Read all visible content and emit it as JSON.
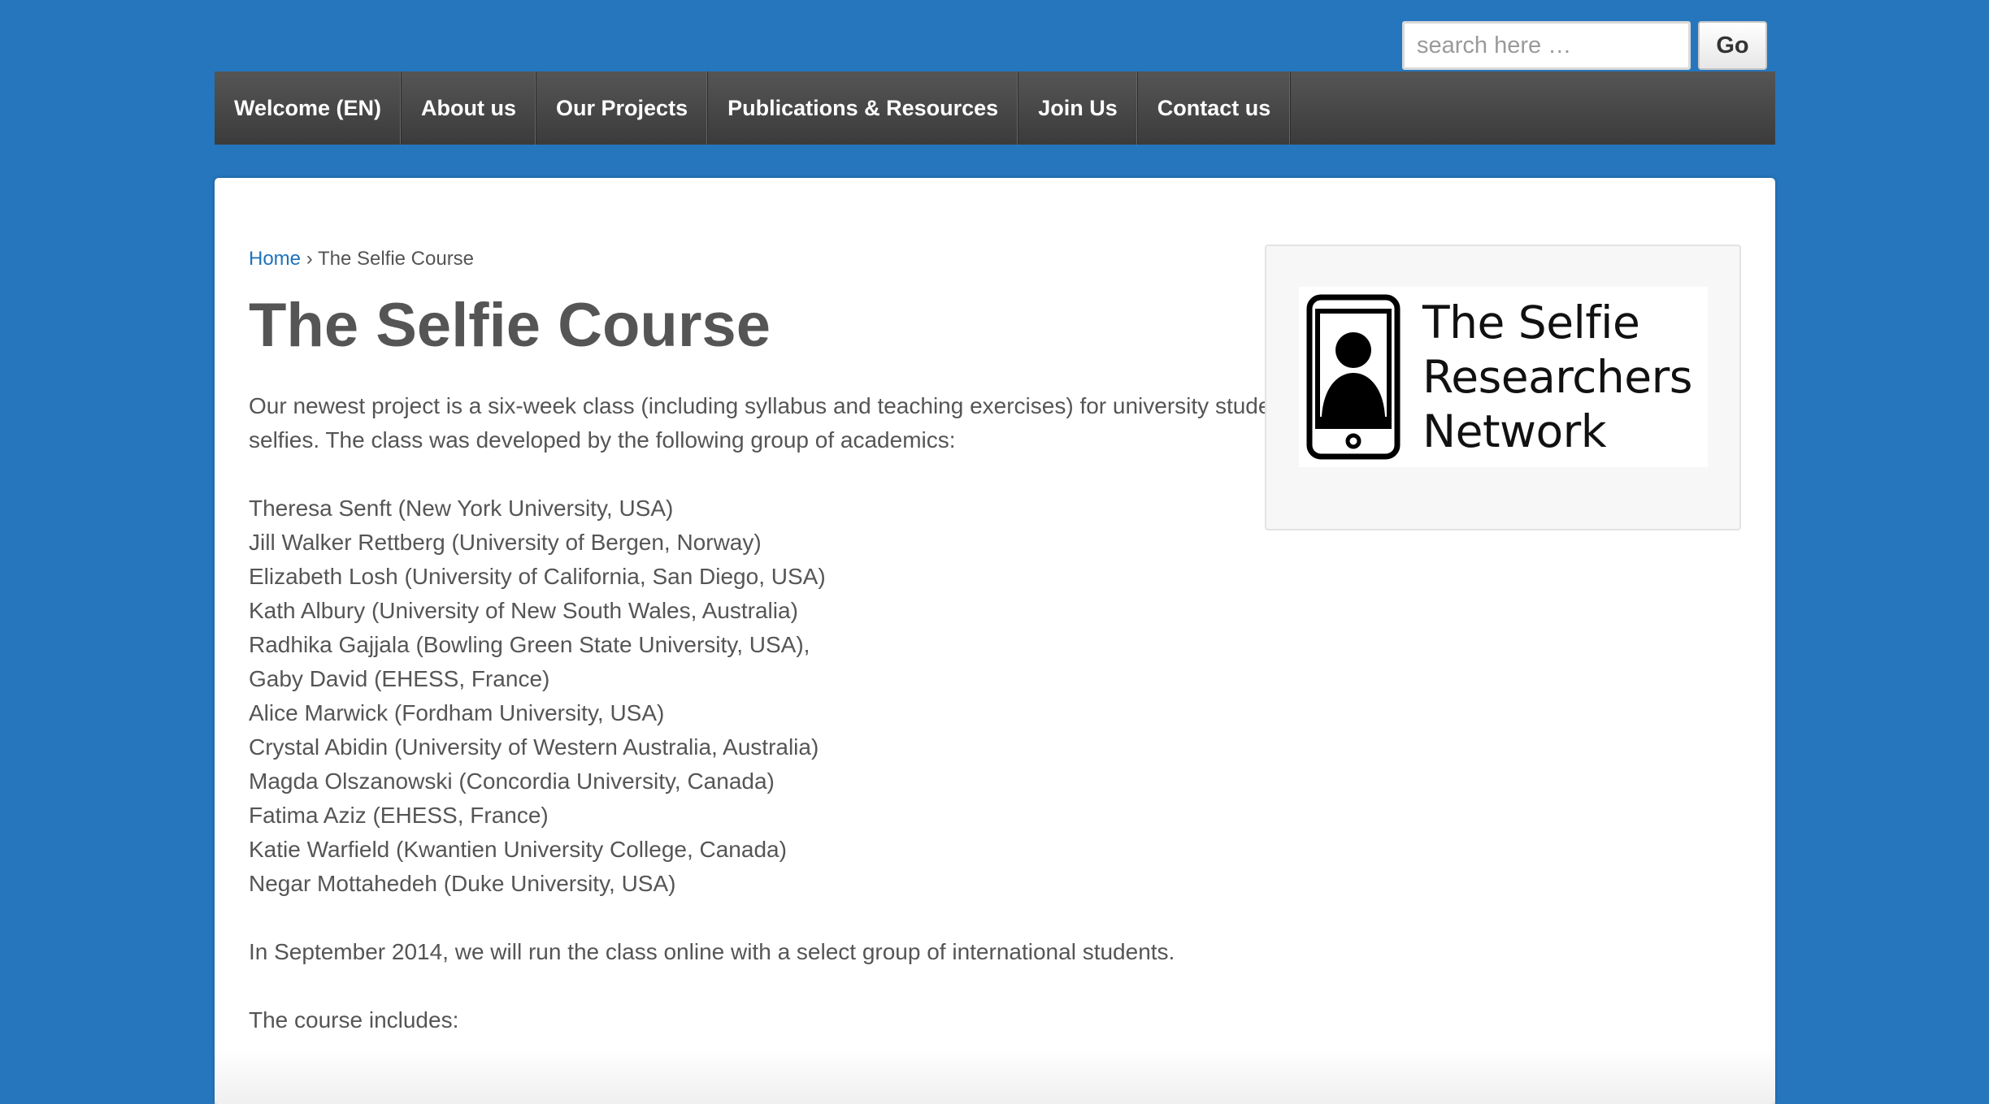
{
  "search": {
    "placeholder": "search here …",
    "button_label": "Go"
  },
  "nav": {
    "items": [
      {
        "label": "Welcome (EN)"
      },
      {
        "label": "About us"
      },
      {
        "label": "Our Projects"
      },
      {
        "label": "Publications & Resources"
      },
      {
        "label": "Join Us"
      },
      {
        "label": "Contact us"
      }
    ]
  },
  "breadcrumb": {
    "home": "Home",
    "separator": "›",
    "current": "The Selfie Course"
  },
  "page": {
    "title": "The Selfie Course",
    "intro": "Our newest project is a six-week class (including syllabus and teaching exercises) for university students studying selfies.  The class was developed by the following group of academics:",
    "academics": [
      "Theresa Senft (New York University, USA)",
      "Jill Walker Rettberg (University of Bergen, Norway)",
      "Elizabeth Losh (University of California, San Diego, USA)",
      "Kath Albury (University of New South Wales, Australia)",
      "Radhika Gajjala (Bowling Green State University, USA),",
      "Gaby David (EHESS, France)",
      "Alice Marwick (Fordham University, USA)",
      "Crystal Abidin (University of Western Australia, Australia)",
      "Magda Olszanowski (Concordia University, Canada)",
      "Fatima Aziz (EHESS, France)",
      "Katie Warfield (Kwantien University College, Canada)",
      "Negar Mottahedeh (Duke University, USA)"
    ],
    "schedule": "In September 2014, we will run the class online with a select group of international students.",
    "includes": "The course includes:"
  },
  "sidebar": {
    "logo": {
      "icon": "phone-person-icon",
      "lines": [
        "The Selfie",
        "Researchers",
        "Network"
      ]
    }
  },
  "colors": {
    "background": "#2576bd",
    "nav": "#4a4a4a",
    "link": "#1e73be",
    "text": "#555555"
  }
}
